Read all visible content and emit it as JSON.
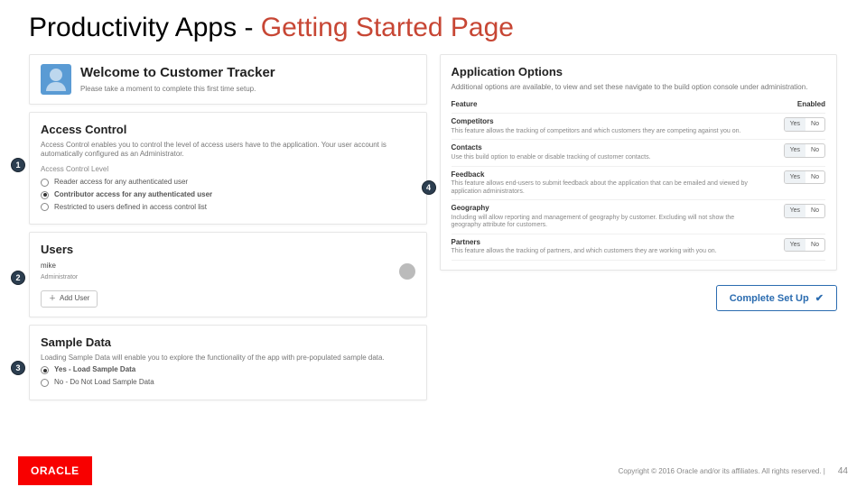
{
  "title_a": "Productivity Apps - ",
  "title_b": "Getting Started Page",
  "callout1": "1",
  "callout2": "2",
  "callout3": "3",
  "callout4": "4",
  "welcome": {
    "heading": "Welcome to Customer Tracker",
    "sub": "Please take a moment to complete this first time setup."
  },
  "access": {
    "heading": "Access Control",
    "desc": "Access Control enables you to control the level of access users have to the application. Your user account is automatically configured as an Administrator.",
    "subhead": "Access Control Level",
    "opt1": "Reader access for any authenticated user",
    "opt2": "Contributor access for any authenticated user",
    "opt3": "Restricted to users defined in access control list"
  },
  "users": {
    "heading": "Users",
    "name": "mike",
    "role": "Administrator",
    "add": "Add User"
  },
  "sample": {
    "heading": "Sample Data",
    "desc": "Loading Sample Data will enable you to explore the functionality of the app with pre-populated sample data.",
    "opt1": "Yes - Load Sample Data",
    "opt2": "No - Do Not Load Sample Data"
  },
  "appopts": {
    "heading": "Application Options",
    "desc": "Additional options are available, to view and set these navigate to the build option console under administration.",
    "col_feature": "Feature",
    "col_enabled": "Enabled",
    "rows": [
      {
        "name": "Competitors",
        "desc": "This feature allows the tracking of competitors and which customers they are competing against you on."
      },
      {
        "name": "Contacts",
        "desc": "Use this build option to enable or disable tracking of customer contacts."
      },
      {
        "name": "Feedback",
        "desc": "This feature allows end-users to submit feedback about the application that can be emailed and viewed by application administrators."
      },
      {
        "name": "Geography",
        "desc": "Including will allow reporting and management of geography by customer. Excluding will not show the geography attribute for customers."
      },
      {
        "name": "Partners",
        "desc": "This feature allows the tracking of partners, and which customers they are working with you on."
      }
    ],
    "yes": "Yes",
    "no": "No"
  },
  "complete": "Complete Set Up",
  "footer": {
    "brand": "ORACLE",
    "copy": "Copyright © 2016 Oracle and/or its affiliates. All rights reserved.   |",
    "page": "44"
  }
}
